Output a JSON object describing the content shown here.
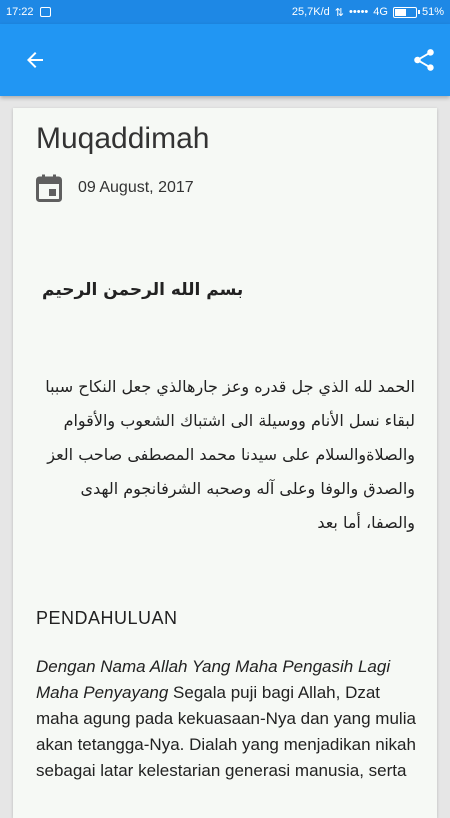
{
  "status_bar": {
    "time": "17:22",
    "network_speed": "25,7K/d",
    "signal": "•••••",
    "network_type": "4G",
    "battery_percent": "51%",
    "battery_level": 0.51
  },
  "app_bar": {
    "back_icon": "arrow-back-icon",
    "share_icon": "share-icon",
    "color": "#2196f3"
  },
  "article": {
    "title": "Muqaddimah",
    "date_icon": "calendar-icon",
    "date": "09 August, 2017",
    "basmala": "بسم الله الرحمن الرحيم",
    "arabic_intro": "الحمد لله الذي جل قدره وعز جارهالذي جعل النكاح سببا لبقاء نسل الأنام ووسيلة الى اشتباك الشعوب والأقوام والصلاةوالسلام على سيدنا محمد المصطفى صاحب العز والصدق والوفا وعلى آله وصحبه الشرفانجوم الهدى والصفا، أما بعد",
    "section_heading": "PENDAHULUAN",
    "para_italic": "Dengan Nama Allah Yang Maha Pengasih Lagi Maha Penyayang",
    "para_text": " Segala puji bagi Allah, Dzat maha agung pada kekuasaan-Nya dan yang mulia akan tetangga-Nya. Dialah yang menjadikan nikah sebagai latar kelestarian generasi manusia, serta"
  }
}
